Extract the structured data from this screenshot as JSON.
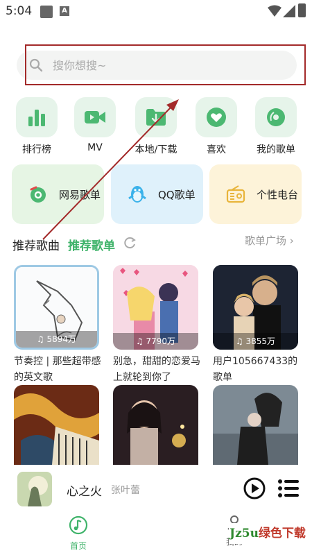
{
  "status": {
    "time": "5:04",
    "notif_letter": "A"
  },
  "search": {
    "placeholder": "搜你想搜~"
  },
  "quick": [
    {
      "label": "排行榜",
      "icon": "bar-chart-icon"
    },
    {
      "label": "MV",
      "icon": "video-camera-icon"
    },
    {
      "label": "本地/下载",
      "icon": "folder-download-icon"
    },
    {
      "label": "喜欢",
      "icon": "heart-icon"
    },
    {
      "label": "我的歌单",
      "icon": "vinyl-disc-icon"
    }
  ],
  "categories": [
    {
      "label": "网易歌单",
      "bg": "#e6f5e4",
      "icon": "netease-icon"
    },
    {
      "label": "QQ歌单",
      "bg": "#dff1fb",
      "icon": "qq-penguin-icon"
    },
    {
      "label": "个性电台",
      "bg": "#fdf3d9",
      "icon": "radio-icon"
    }
  ],
  "section": {
    "title": "推荐歌曲",
    "tab": "推荐歌单",
    "more": "歌单广场 ›"
  },
  "playlists": [
    {
      "count": "5894万",
      "title": "节奏控 | 那些超带感的英文歌"
    },
    {
      "count": "7790万",
      "title": "别急，甜甜的恋爱马上就轮到你了"
    },
    {
      "count": "3855万",
      "title": "用户105667433的歌单"
    },
    {
      "count": "",
      "title": ""
    },
    {
      "count": "",
      "title": ""
    },
    {
      "count": "",
      "title": ""
    }
  ],
  "player": {
    "song": "心之火",
    "artist": "张叶蕾"
  },
  "nav": {
    "home": "首页",
    "mine": "我的"
  },
  "watermark": {
    "a": "Jz5u",
    "b": "绿色下载"
  },
  "colors": {
    "accent": "#3fb36a",
    "annotation": "#a32a2a"
  }
}
